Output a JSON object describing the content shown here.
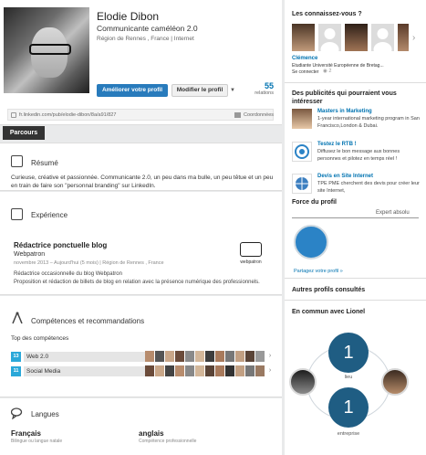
{
  "profile": {
    "name": "Elodie Dibon",
    "headline": "Communicante caméléon 2.0",
    "location": "Région de Rennes , France | Internet",
    "improve_button": "Améliorer votre profil",
    "edit_button": "Modifier le profil",
    "relations_count": "55",
    "relations_label": "relations",
    "public_url": "fr.linkedin.com/pub/elodie-dibon/8a/a91/827",
    "coordinates_label": "Coordonnées"
  },
  "tabs": {
    "parcours": "Parcours"
  },
  "resume": {
    "title": "Résumé",
    "text": "Curieuse, créative et passionnée. Communicante 2.0, un peu dans ma bulle, un peu têtue et un peu en train de faire son \"personnal branding\" sur LinkedIn."
  },
  "experience": {
    "title": "Expérience",
    "job_title": "Rédactrice ponctuelle blog",
    "company": "Webpatron",
    "dates": "novembre 2013 – Aujourd'hui (5 mois) | Région de Rennes , France",
    "description": "Rédactrice occasionnelle du blog Webpatron\nProposition et rédaction de billets de blog en relation avec la présence numérique des professionnels.",
    "logo_text": "webpatron"
  },
  "skills": {
    "title": "Compétences et recommandations",
    "top_label": "Top des compétences",
    "items": [
      {
        "count": "13",
        "name": "Web 2.0"
      },
      {
        "count": "11",
        "name": "Social Media"
      }
    ]
  },
  "languages": {
    "title": "Langues",
    "items": [
      {
        "name": "Français",
        "level": "Bilingue ou langue natale"
      },
      {
        "name": "anglais",
        "level": "Compétence professionnelle"
      }
    ]
  },
  "sidebar": {
    "suggestions_title": "Les connaissez-vous ?",
    "suggestion": {
      "name": "Clémence",
      "description": "Étudiante Université Européenne de Bretag...",
      "connect": "Se connecter",
      "views": "2"
    },
    "ads_title": "Des publicités qui pourraient vous intéresser",
    "ads": [
      {
        "title": "Masters in Marketing",
        "text": "1-year international marketing program in San Francisco,London & Dubai."
      },
      {
        "title": "Testez le RTB !",
        "text": "Diffusez le bon message aux bonnes personnes et pilotez en temps réel !"
      },
      {
        "title": "Devis en Site Internet",
        "text": "TPE PME cherchent des devis pour créer leur site Internet,"
      }
    ],
    "strength_title": "Force du profil",
    "strength_level": "Expert absolu",
    "share_link": "Partagez votre profil »",
    "other_profiles_title": "Autres profils consultés",
    "common_title": "En commun avec Lionel",
    "common_top_count": "1",
    "common_top_label": "lieu",
    "common_bottom_count": "1",
    "common_bottom_label": "entreprise"
  }
}
